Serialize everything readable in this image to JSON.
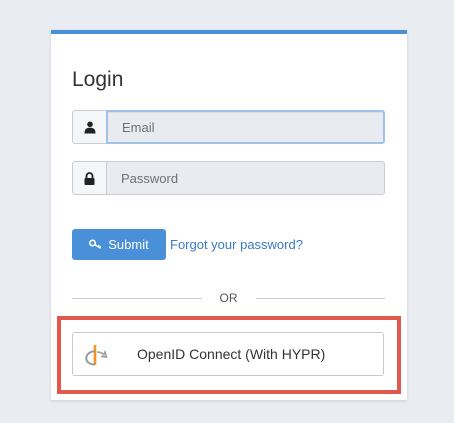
{
  "login": {
    "title": "Login",
    "email_placeholder": "Email",
    "password_placeholder": "Password",
    "submit_label": "Submit",
    "forgot_label": "Forgot your password?",
    "divider_label": "OR",
    "oidc_label": "OpenID Connect (With HYPR)"
  },
  "icons": {
    "email": "user-icon",
    "password": "lock-icon",
    "submit": "key-icon",
    "oidc": "openid-logo-icon"
  },
  "colors": {
    "accent": "#4a90d9",
    "link": "#3a7bc8",
    "highlight": "#df5a4a",
    "openid_orange": "#f7931e"
  }
}
